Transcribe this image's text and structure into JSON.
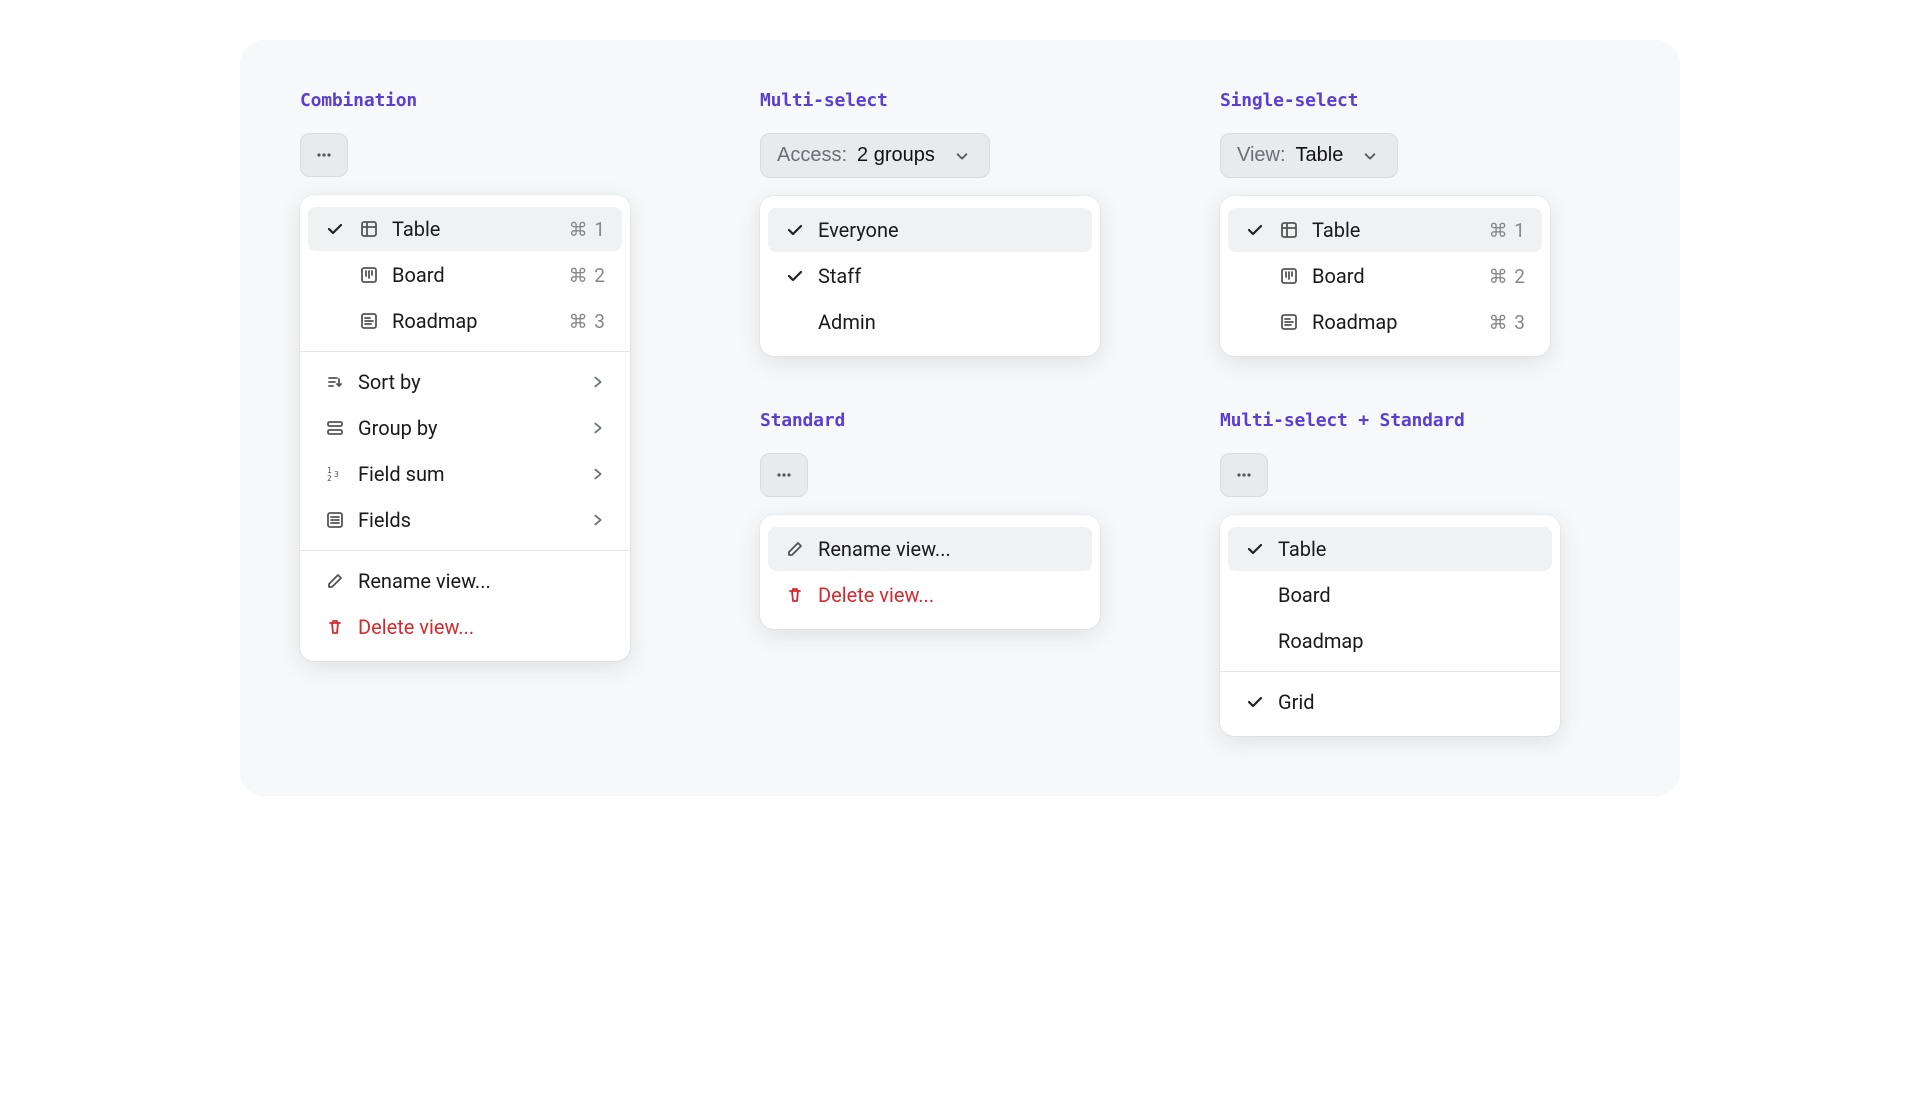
{
  "sections": {
    "combination": {
      "title": "Combination",
      "views": [
        {
          "label": "Table",
          "shortcut": "⌘ 1",
          "checked": true,
          "icon": "table"
        },
        {
          "label": "Board",
          "shortcut": "⌘ 2",
          "checked": false,
          "icon": "board"
        },
        {
          "label": "Roadmap",
          "shortcut": "⌘ 3",
          "checked": false,
          "icon": "roadmap"
        }
      ],
      "options": [
        {
          "label": "Sort by",
          "icon": "sort"
        },
        {
          "label": "Group by",
          "icon": "group"
        },
        {
          "label": "Field sum",
          "icon": "sum"
        },
        {
          "label": "Fields",
          "icon": "fields"
        }
      ],
      "actions": {
        "rename": "Rename view...",
        "delete": "Delete view..."
      }
    },
    "multi_select": {
      "title": "Multi-select",
      "trigger_prefix": "Access: ",
      "trigger_value": "2 groups",
      "items": [
        {
          "label": "Everyone",
          "checked": true
        },
        {
          "label": "Staff",
          "checked": true
        },
        {
          "label": "Admin",
          "checked": false
        }
      ]
    },
    "single_select": {
      "title": "Single-select",
      "trigger_prefix": "View: ",
      "trigger_value": "Table",
      "items": [
        {
          "label": "Table",
          "shortcut": "⌘ 1",
          "checked": true,
          "icon": "table"
        },
        {
          "label": "Board",
          "shortcut": "⌘ 2",
          "checked": false,
          "icon": "board"
        },
        {
          "label": "Roadmap",
          "shortcut": "⌘ 3",
          "checked": false,
          "icon": "roadmap"
        }
      ]
    },
    "standard": {
      "title": "Standard",
      "actions": {
        "rename": "Rename view...",
        "delete": "Delete view..."
      }
    },
    "multi_standard": {
      "title": "Multi-select + Standard",
      "group1": [
        {
          "label": "Table",
          "checked": true
        },
        {
          "label": "Board",
          "checked": false
        },
        {
          "label": "Roadmap",
          "checked": false
        }
      ],
      "group2": [
        {
          "label": "Grid",
          "checked": true
        }
      ]
    }
  }
}
